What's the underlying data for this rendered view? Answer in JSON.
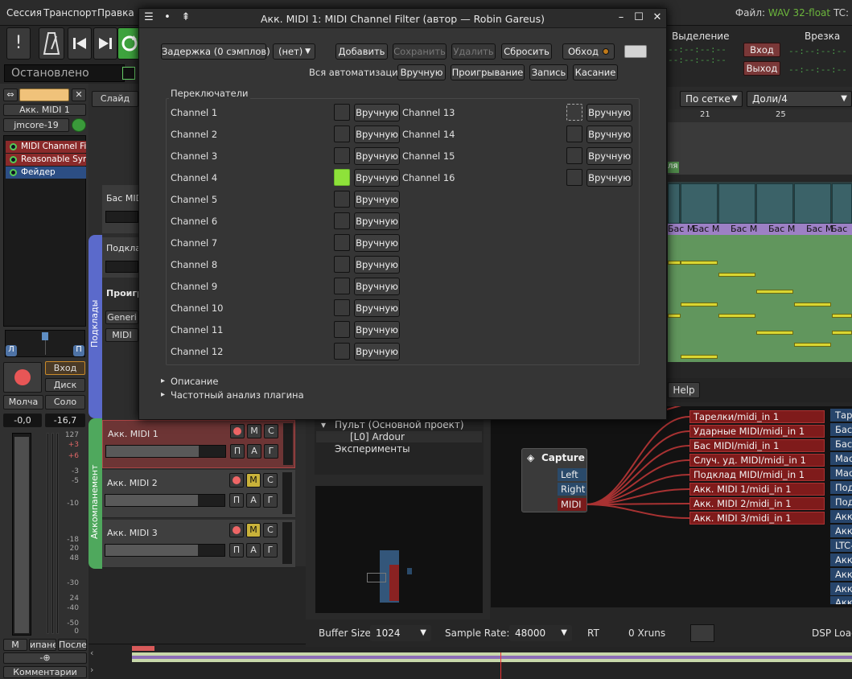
{
  "menubar": {
    "items": [
      "Сессия",
      "Транспорт",
      "Правка"
    ],
    "file_label": "Файл:",
    "file_format": "WAV 32-float",
    "tc_label": "TC:"
  },
  "transport": {
    "status": "Остановлено"
  },
  "editor_strip": {
    "track_name": "Акк. MIDI 1",
    "instrument": "jmcore-19",
    "plugins": [
      "MIDI Channel Fil",
      "Reasonable Syn",
      "Фейдер"
    ],
    "pan_left": "Л",
    "pan_right": "П",
    "input_btn": "Вход",
    "disk_btn": "Диск",
    "mute_btn": "Молча",
    "solo_btn": "Соло",
    "gain_value": "-0,0",
    "peak_value": "-16,7",
    "meter_scale": [
      "127",
      "+3",
      "+6",
      "-3",
      "-5",
      "-10",
      "-18",
      "20",
      "48",
      "-30",
      "24",
      "-40",
      "-50",
      "0"
    ],
    "bottom_btns": [
      "М",
      "ипане",
      "После"
    ],
    "comments_btn": "Комментарии",
    "phase_btn": "-⊕"
  },
  "tracks": {
    "slide_label": "Слайд",
    "group_pads": "Подклады",
    "group_accomp": "Аккомпанемент",
    "partial_names": [
      "Бас MIDI",
      "Подкла",
      "Проигр",
      "Generi",
      "MIDI"
    ],
    "midi_tracks": [
      {
        "name": "Акк. MIDI 1",
        "m": "M",
        "c": "С",
        "p": "П",
        "a": "А",
        "g": "Г"
      },
      {
        "name": "Акк. MIDI 2",
        "m": "M",
        "c": "С",
        "p": "П",
        "a": "А",
        "g": "Г"
      },
      {
        "name": "Акк. MIDI 3",
        "m": "M",
        "c": "С",
        "p": "П",
        "a": "А",
        "g": "Г"
      }
    ]
  },
  "dialog": {
    "title": "Акк. MIDI 1: MIDI Channel Filter (автор — Robin Gareus)",
    "latency_btn": "Задержка (0 сэмплов)",
    "preset_select": "(нет)",
    "add_btn": "Добавить",
    "save_btn": "Сохранить",
    "delete_btn": "Удалить",
    "reset_btn": "Сбросить",
    "bypass_btn": "Обход",
    "all_automation_label": "Вся автоматизация",
    "auto_manual": "Вручную",
    "auto_play": "Проигрывание",
    "auto_write": "Запись",
    "auto_touch": "Касание",
    "switches_title": "Переключатели",
    "manual_label": "Вручную",
    "channels_left": [
      "Channel  1",
      "Channel  2",
      "Channel  3",
      "Channel  4",
      "Channel  5",
      "Channel  6",
      "Channel  7",
      "Channel  8",
      "Channel  9",
      "Channel 10",
      "Channel 11",
      "Channel 12"
    ],
    "channels_right": [
      "Channel 13",
      "Channel 14",
      "Channel 15",
      "Channel 16"
    ],
    "active_channel_index": 3,
    "description_expander": "Описание",
    "analysis_expander": "Частотный анализ плагина"
  },
  "right_panel": {
    "selection_label": "Выделение",
    "punch_label": "Врезка",
    "in_btn": "Вход",
    "out_btn": "Выход",
    "timecode_placeholder": "--:--:--:--",
    "snap_select": "По сетке",
    "grid_select": "Доли/4",
    "ruler_marks": [
      "21",
      "25"
    ],
    "clip_label": "ля",
    "midi_regions": [
      "Бас М",
      "Бас М",
      "Бас М",
      "Бас М",
      "Бас М",
      "Бас М"
    ],
    "help_btn": "Help"
  },
  "mixer_tree": {
    "root": "Пульт (Основной проект)",
    "child": "[L0] Ardour",
    "experiments": "Эксперименты"
  },
  "connections": {
    "capture_title": "Capture",
    "capture_ports": [
      "Left",
      "Right",
      "MIDI"
    ],
    "midi_inputs": [
      "Тарелки/midi_in 1",
      "Ударные MIDI/midi_in 1",
      "Бас MIDI/midi_in 1",
      "Случ. уд. MIDI/midi_in 1",
      "Подклад MIDI/midi_in 1",
      "Акк. MIDI 1/midi_in 1",
      "Акк. MIDI 2/midi_in 1",
      "Акк. MIDI 3/midi_in 1"
    ],
    "right_ports": [
      "Тар",
      "Бас",
      "Бас",
      "Мас",
      "Мас",
      "Под",
      "Под",
      "Акк",
      "Акк",
      "LTC-",
      "Акк",
      "Акк",
      "Акк",
      "Акк"
    ]
  },
  "statusbar": {
    "buffer_label": "Buffer Size:",
    "buffer_value": "1024",
    "rate_label": "Sample Rate:",
    "rate_value": "48000",
    "rt_label": "RT",
    "xruns": "0 Xruns",
    "dsp_label": "DSP Load"
  }
}
